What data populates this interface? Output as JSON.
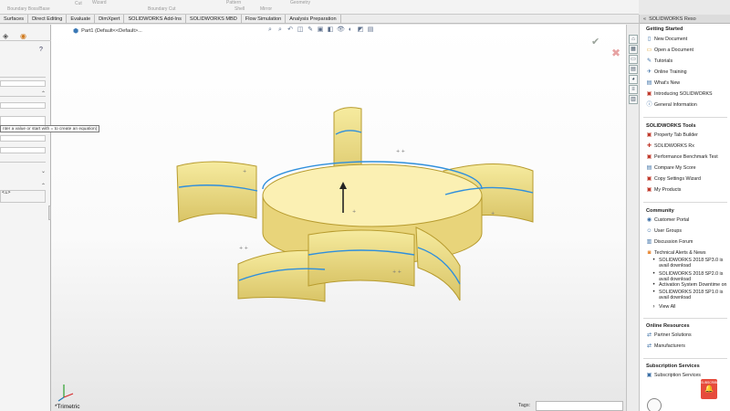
{
  "command_manager": {
    "faded_labels": [
      "Boundary Boss/Base",
      "Wizard",
      "Cut",
      "Boundary Cut",
      "Pattern",
      "Shell",
      "Mirror",
      "Geometry"
    ]
  },
  "tabs": [
    "Surfaces",
    "Direct Editing",
    "Evaluate",
    "DimXpert",
    "SOLIDWORKS Add-Ins",
    "SOLIDWORKS MBD",
    "Flow Simulation",
    "Analysis Preparation"
  ],
  "left_panel": {
    "help_glyph": "?",
    "equation_field_value": "<1>",
    "tooltip": "nter a value or start with = to create an equation)"
  },
  "viewport": {
    "breadcrumb_part": "Part1 (Default<<Default>...",
    "view_label": "*Trimetric",
    "tags_label": "Tags:",
    "tags_value": ""
  },
  "task_pane": {
    "title": "SOLIDWORKS Reso",
    "getting_started": {
      "title": "Getting Started",
      "items": [
        "New Document",
        "Open a Document",
        "Tutorials",
        "Online Training",
        "What's New",
        "Introducing SOLIDWORKS",
        "General Information"
      ]
    },
    "tools": {
      "title": "SOLIDWORKS Tools",
      "items": [
        "Property Tab Builder",
        "SOLIDWORKS Rx",
        "Performance Benchmark Test",
        "Compare My Score",
        "Copy Settings Wizard",
        "My Products"
      ]
    },
    "community": {
      "title": "Community",
      "items": [
        "Customer Portal",
        "User Groups",
        "Discussion Forum",
        "Technical Alerts & News"
      ],
      "news": [
        "SOLIDWORKS 2018 SP3.0 is avail download",
        "SOLIDWORKS 2018 SP2.0 is avail download",
        "Activation System Downtime on",
        "SOLIDWORKS 2018 SP1.0 is avail download"
      ],
      "view_all": "View All"
    },
    "online_resources": {
      "title": "Online Resources",
      "items": [
        "Partner Solutions",
        "Manufacturers"
      ]
    },
    "subscription": {
      "title": "Subscription Services",
      "items": [
        "Subscription Services"
      ]
    },
    "subscribe_badge": "SUBSCRIBE"
  },
  "colors": {
    "model_fill": "#f6eb9f",
    "model_edge": "#b79b2e",
    "selection_edge": "#2f8fdc",
    "badge": "#e64b3c"
  }
}
